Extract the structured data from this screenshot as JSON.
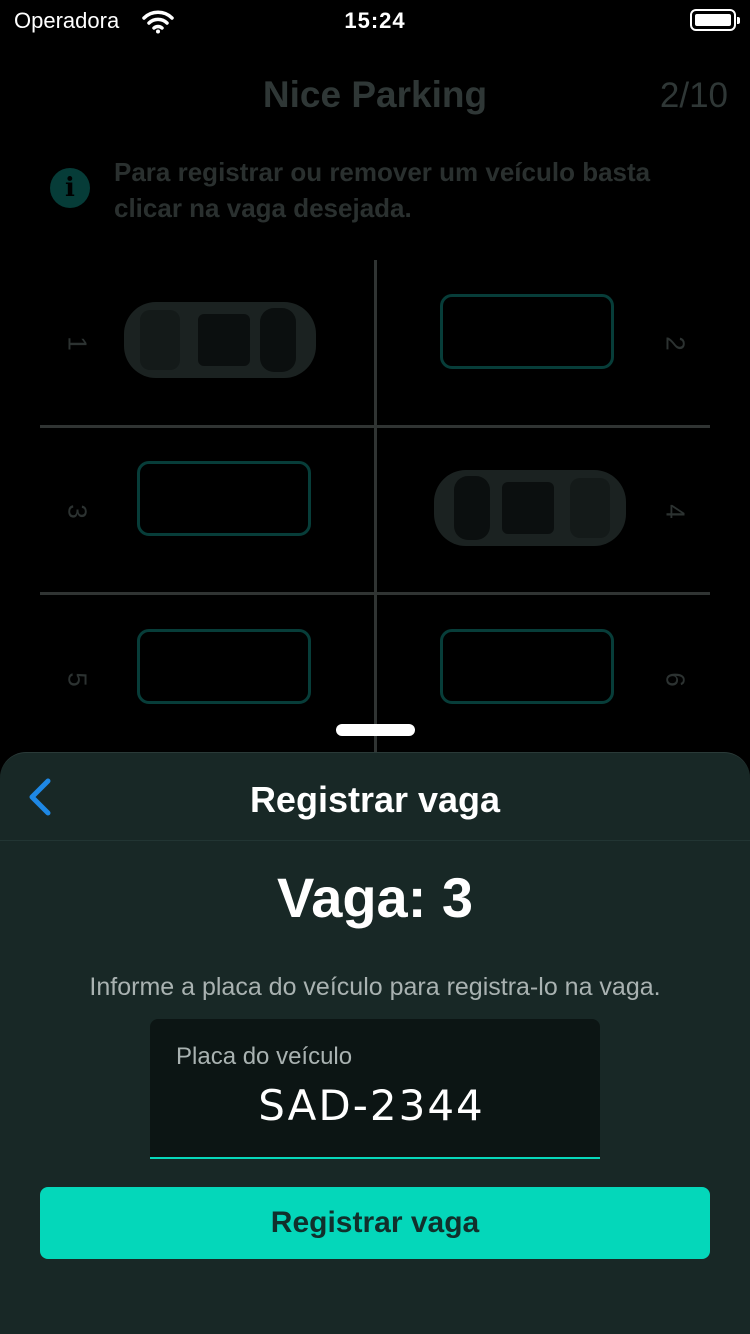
{
  "status_bar": {
    "carrier": "Operadora",
    "time": "15:24",
    "icons": [
      "wifi-icon",
      "battery-icon"
    ]
  },
  "background": {
    "title": "Nice Parking",
    "counter": "2/10",
    "info_icon": "info-icon",
    "info_text": "Para registrar ou remover um veículo basta clicar na vaga desejada.",
    "slots": [
      {
        "number": "1",
        "occupied": true
      },
      {
        "number": "2",
        "occupied": false
      },
      {
        "number": "3",
        "occupied": false
      },
      {
        "number": "4",
        "occupied": true
      },
      {
        "number": "5",
        "occupied": false
      },
      {
        "number": "6",
        "occupied": false
      }
    ]
  },
  "sheet": {
    "back_icon": "chevron-left-icon",
    "title": "Registrar vaga",
    "slot_label": "Vaga: 3",
    "instructions": "Informe a placa do veículo para registra-lo na vaga.",
    "plate_field": {
      "label": "Placa do veículo",
      "value": "SAD-2344"
    },
    "submit_label": "Registrar vaga"
  },
  "colors": {
    "accent": "#04d7ba",
    "back_icon": "#1e88e5",
    "sheet_bg": "#182826",
    "field_bg": "#0c1514"
  }
}
